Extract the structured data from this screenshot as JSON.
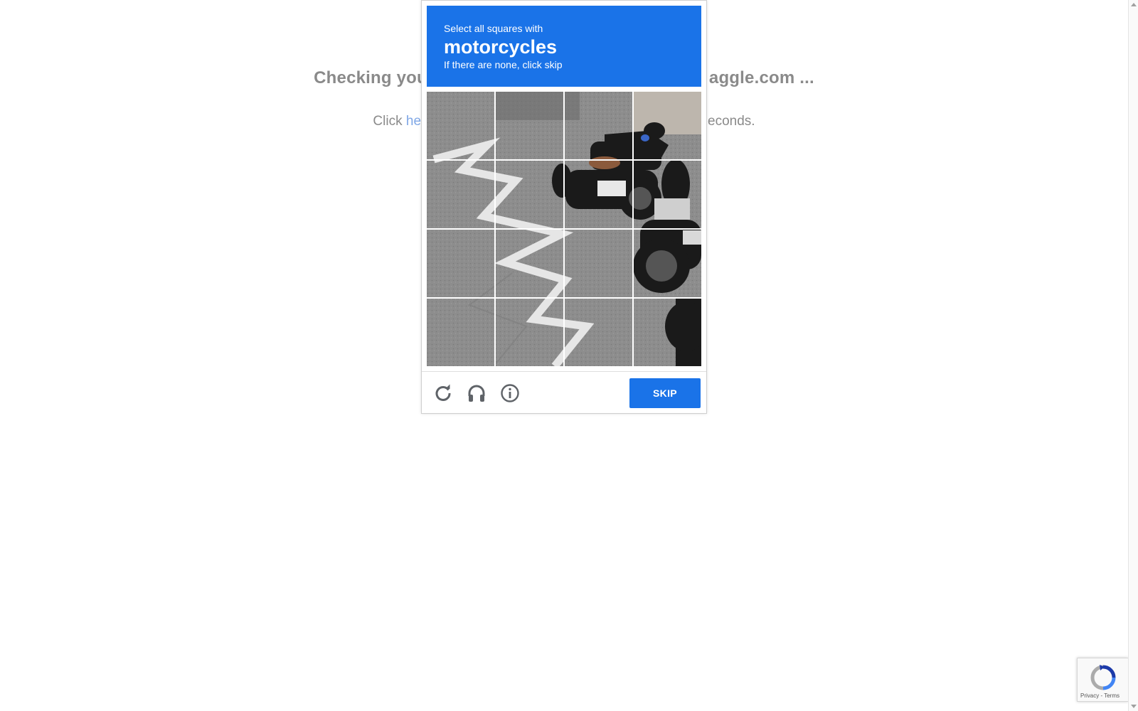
{
  "background_page": {
    "heading_left": "Checking you",
    "heading_right": "aggle.com ...",
    "line_prefix": "Click ",
    "line_link": "he",
    "line_suffix": "econds."
  },
  "captcha": {
    "header": {
      "intro": "Select all squares with",
      "target": "motorcycles",
      "hint": "If there are none, click skip"
    },
    "grid": {
      "rows": 4,
      "cols": 4
    },
    "footer": {
      "reload_icon": "reload-icon",
      "audio_icon": "headphones-icon",
      "info_icon": "info-icon",
      "skip_label": "SKIP"
    },
    "colors": {
      "header_bg": "#1a73e8",
      "button_bg": "#1a73e8"
    }
  },
  "recaptcha_badge": {
    "privacy": "Privacy",
    "separator": " - ",
    "terms": "Terms"
  }
}
